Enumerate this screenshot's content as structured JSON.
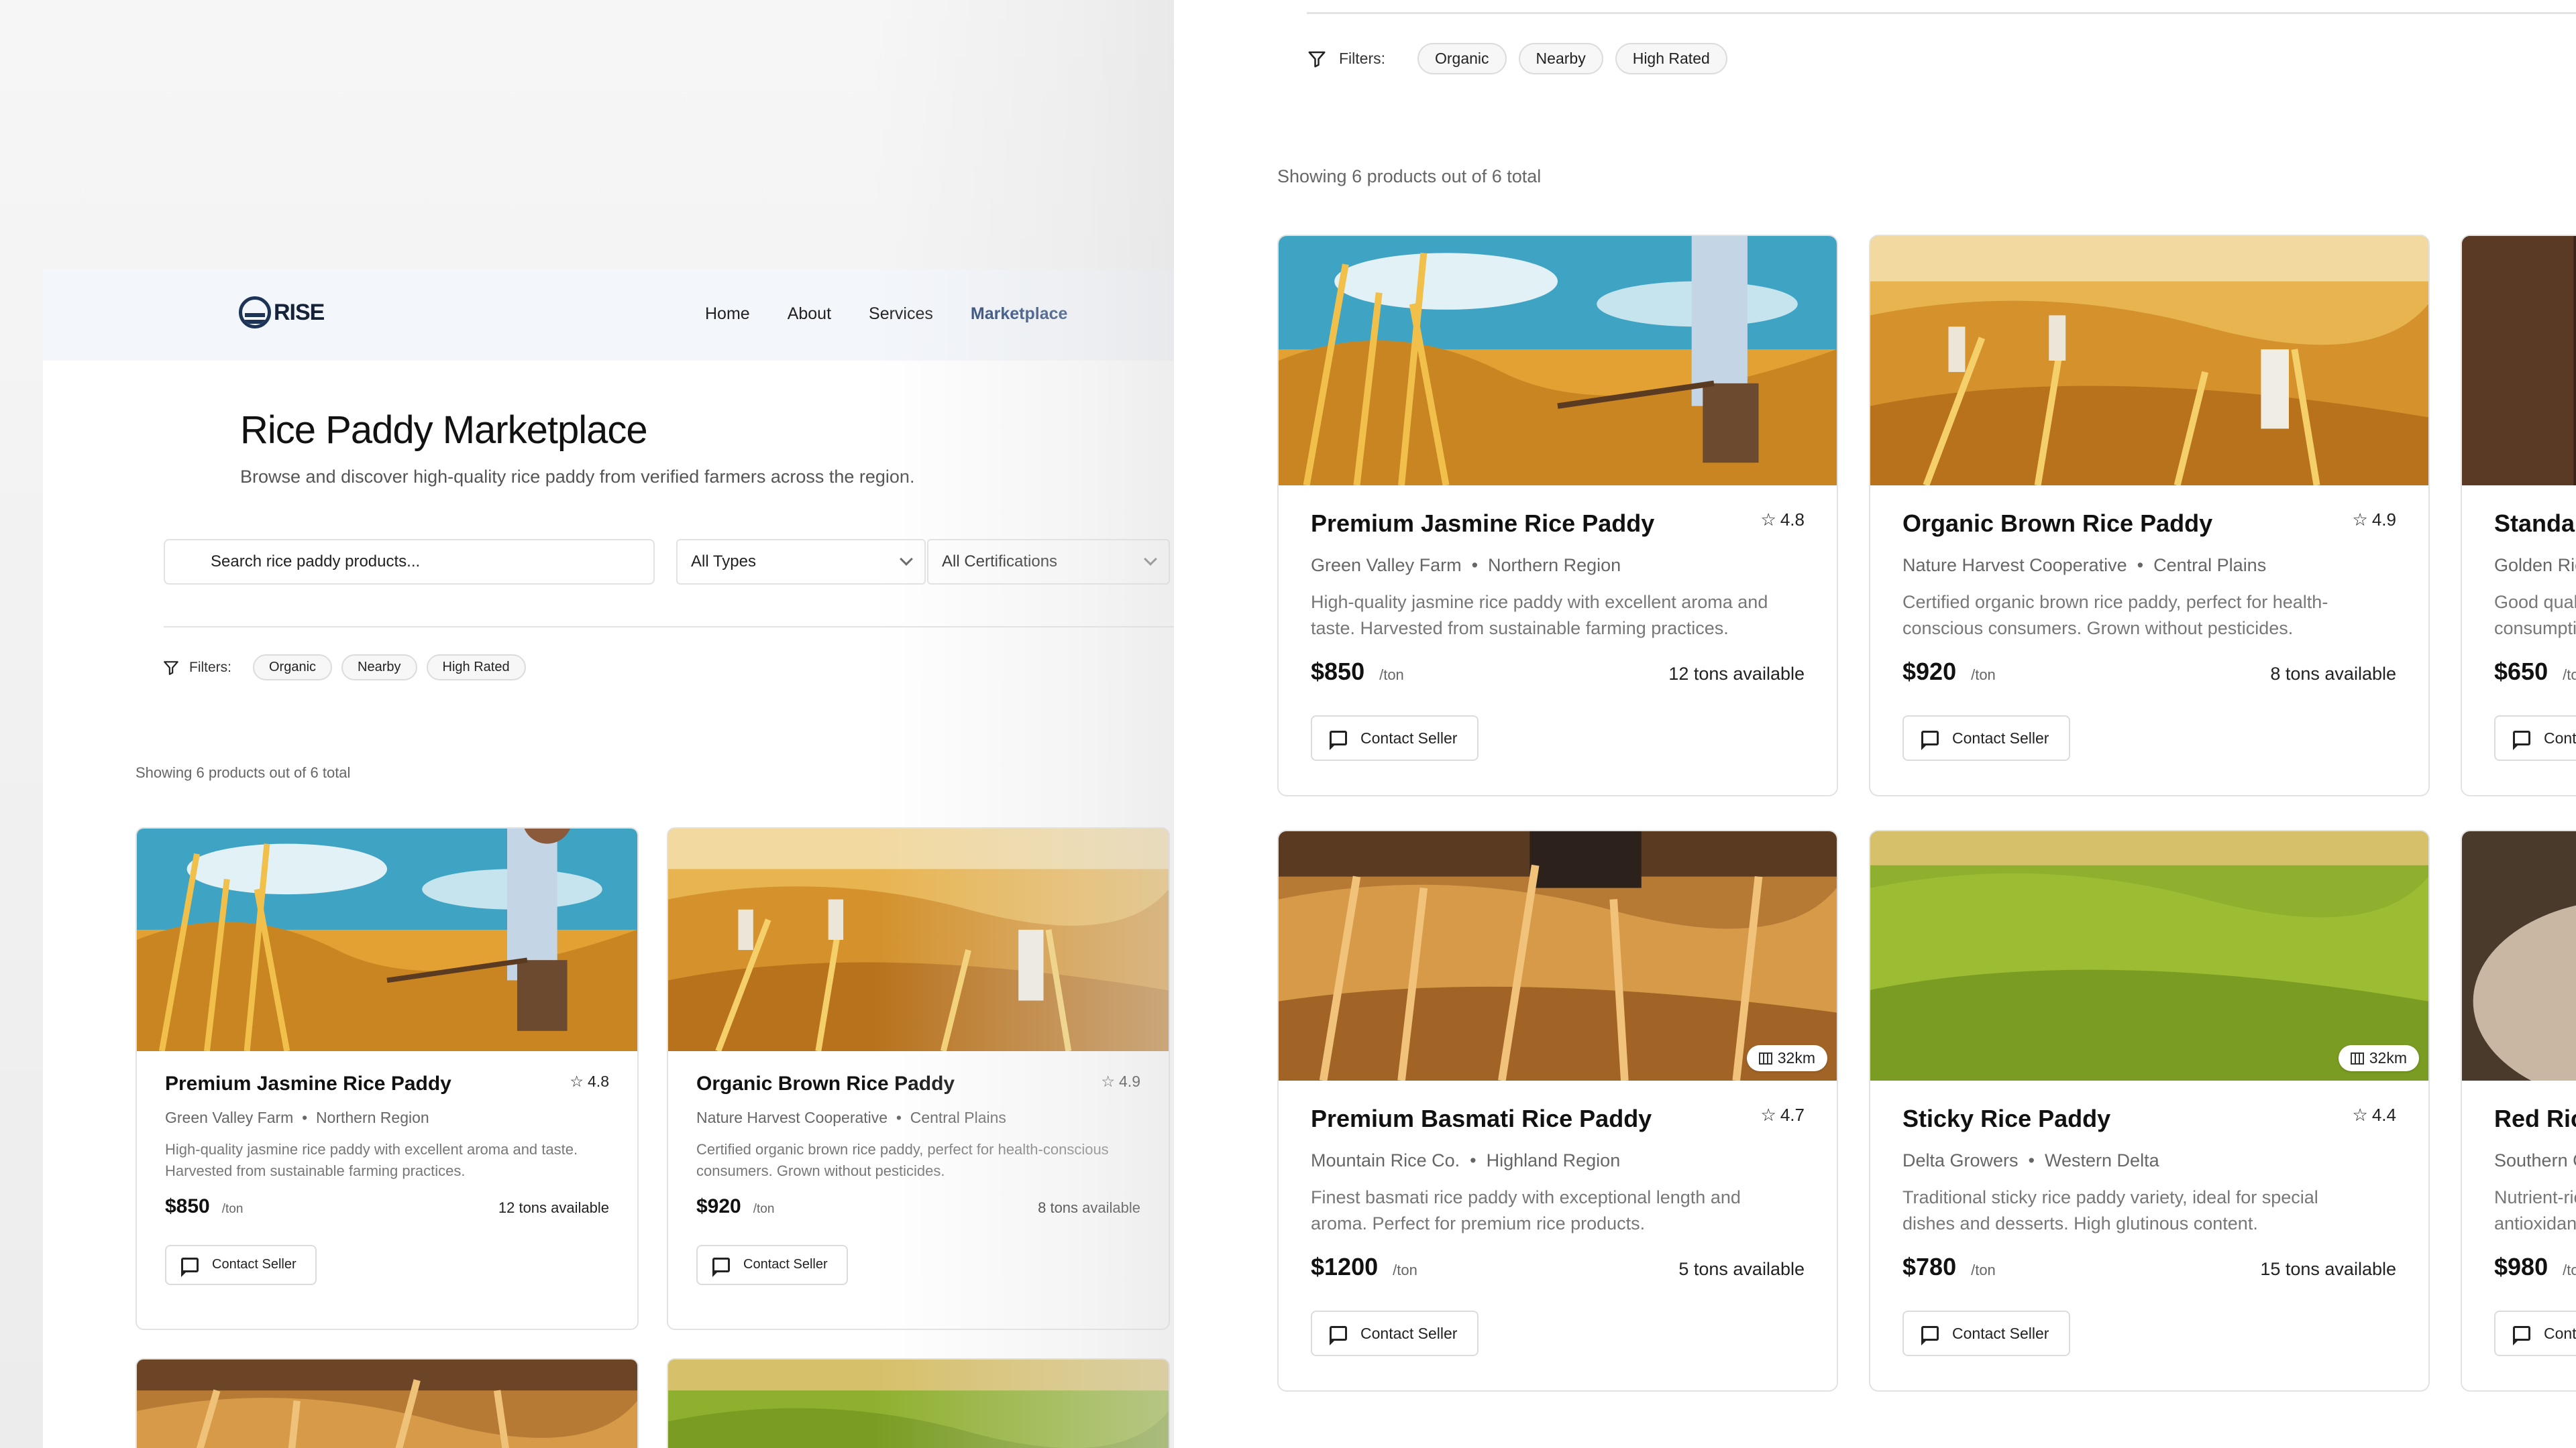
{
  "brand": {
    "name": "RISE"
  },
  "nav": {
    "links": [
      "Home",
      "About",
      "Services",
      "Marketplace"
    ],
    "active": "Marketplace"
  },
  "hero": {
    "title": "Rice Paddy Marketplace",
    "subtitle": "Browse and discover high-quality rice paddy from verified farmers across the region."
  },
  "search": {
    "placeholder": "Search rice paddy products..."
  },
  "selects": {
    "types": "All Types",
    "certifications": "All Certifications"
  },
  "filters": {
    "label": "Filters:",
    "chips": [
      "Organic",
      "Nearby",
      "High Rated"
    ]
  },
  "results": {
    "showing": "Showing 6 products out of 6 total"
  },
  "contact_label": "Contact Seller",
  "unit_label": "/ton",
  "products": [
    {
      "title": "Premium Jasmine Rice Paddy",
      "rating": "4.8",
      "farm": "Green Valley Farm",
      "region": "Northern Region",
      "desc": "High-quality jasmine rice paddy with excellent aroma and taste. Harvested from sustainable farming practices.",
      "price": "$850",
      "available": "12 tons available",
      "distance": ""
    },
    {
      "title": "Organic Brown Rice Paddy",
      "rating": "4.9",
      "farm": "Nature Harvest Cooperative",
      "region": "Central Plains",
      "desc": "Certified organic brown rice paddy, perfect for health-conscious consumers. Grown without pesticides.",
      "price": "$920",
      "available": "8 tons available",
      "distance": ""
    },
    {
      "title": "Standard Rice Paddy",
      "rating": "",
      "farm": "Golden Rice Fields",
      "region": "",
      "desc": "Good quality standard rice paddy for everyday consumption.",
      "price": "$650",
      "available": "",
      "distance": ""
    },
    {
      "title": "Premium Basmati Rice Paddy",
      "rating": "4.7",
      "farm": "Mountain Rice Co.",
      "region": "Highland Region",
      "desc": "Finest basmati rice paddy with exceptional length and aroma. Perfect for premium rice products.",
      "price": "$1200",
      "available": "5 tons available",
      "distance": "32km"
    },
    {
      "title": "Sticky Rice Paddy",
      "rating": "4.4",
      "farm": "Delta Growers",
      "region": "Western Delta",
      "desc": "Traditional sticky rice paddy variety, ideal for special dishes and desserts. High glutinous content.",
      "price": "$780",
      "available": "15 tons available",
      "distance": "32km"
    },
    {
      "title": "Red Rice Paddy",
      "rating": "",
      "farm": "Southern Co-op",
      "region": "",
      "desc": "Nutrient-rich red rice paddy with nutty flavor. High in antioxidants.",
      "price": "$980",
      "available": "",
      "distance": ""
    }
  ]
}
